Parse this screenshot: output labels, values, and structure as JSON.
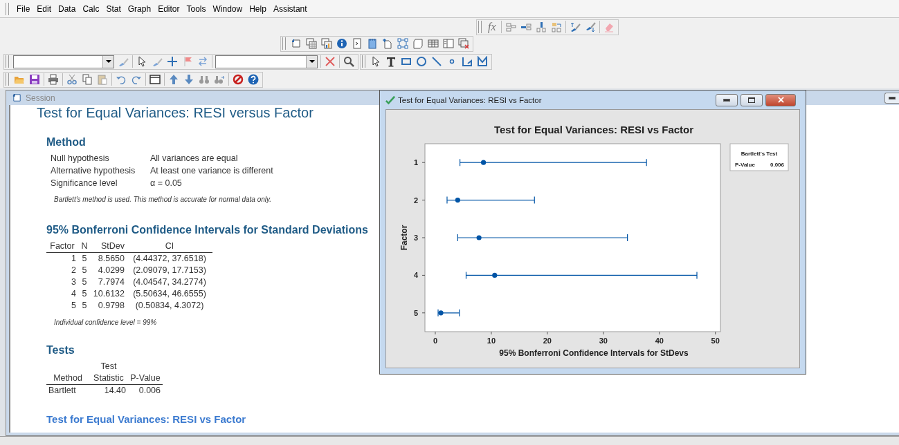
{
  "menu": [
    {
      "label": "File"
    },
    {
      "label": "Edit"
    },
    {
      "label": "Data"
    },
    {
      "label": "Calc"
    },
    {
      "label": "Stat"
    },
    {
      "label": "Graph"
    },
    {
      "label": "Editor"
    },
    {
      "label": "Tools"
    },
    {
      "label": "Window"
    },
    {
      "label": "Help"
    },
    {
      "label": "Assistant"
    }
  ],
  "formula_toolbar": {
    "label": "fx"
  },
  "session": {
    "title": "Session",
    "heading": "Test for Equal Variances: RESI versus Factor",
    "method": {
      "title": "Method",
      "rows": [
        {
          "label": "Null hypothesis",
          "value": "All variances are equal"
        },
        {
          "label": "Alternative hypothesis",
          "value": "At least one variance is different"
        },
        {
          "label": "Significance level",
          "value": "α = 0.05"
        }
      ],
      "note": "Bartlett's method is used. This method is accurate for normal data only."
    },
    "ci": {
      "title": "95% Bonferroni Confidence Intervals for Standard Deviations",
      "columns": [
        "Factor",
        "N",
        "StDev",
        "CI"
      ],
      "rows": [
        [
          "1",
          "5",
          "8.5650",
          "(4.44372, 37.6518)"
        ],
        [
          "2",
          "5",
          "4.0299",
          "(2.09079, 17.7153)"
        ],
        [
          "3",
          "5",
          "7.7974",
          "(4.04547, 34.2774)"
        ],
        [
          "4",
          "5",
          "10.6132",
          "(5.50634, 46.6555)"
        ],
        [
          "5",
          "5",
          "0.9798",
          "(0.50834, 4.3072)"
        ]
      ],
      "note": "Individual confidence level = 99%"
    },
    "tests": {
      "title": "Tests",
      "columns": [
        {
          "label": "Method"
        },
        {
          "top": "Test",
          "label": "Statistic"
        },
        {
          "label": "P-Value"
        }
      ],
      "rows": [
        [
          "Bartlett",
          "14.40",
          "0.006"
        ]
      ]
    },
    "next_heading": "Test for Equal Variances: RESI vs Factor"
  },
  "graph_window": {
    "title": "Test for Equal Variances: RESI vs Factor",
    "legend": {
      "title": "Bartlett's Test",
      "label": "P-Value",
      "value": "0.006"
    },
    "chart_data": {
      "type": "scatter",
      "orientation": "horizontal",
      "title": "Test for Equal Variances: RESI vs Factor",
      "xlabel": "95% Bonferroni Confidence Intervals for StDevs",
      "ylabel": "Factor",
      "categories": [
        "1",
        "2",
        "3",
        "4",
        "5"
      ],
      "series": [
        {
          "color": "#0054a6",
          "values": [
            8.6,
            4.0,
            7.8,
            10.6,
            1.0
          ],
          "errors": [
            [
              4.4,
              37.7
            ],
            [
              2.1,
              17.7
            ],
            [
              4.0,
              34.3
            ],
            [
              5.5,
              46.7
            ],
            [
              0.5,
              4.3
            ]
          ]
        }
      ],
      "xlim": [
        -1.85,
        50.9
      ],
      "xticks": [
        {
          "value": 0,
          "label": "0"
        },
        {
          "value": 10,
          "label": "10"
        },
        {
          "value": 20,
          "label": "20"
        },
        {
          "value": 30,
          "label": "30"
        },
        {
          "value": 40,
          "label": "40"
        },
        {
          "value": 50,
          "label": "50"
        }
      ]
    }
  }
}
